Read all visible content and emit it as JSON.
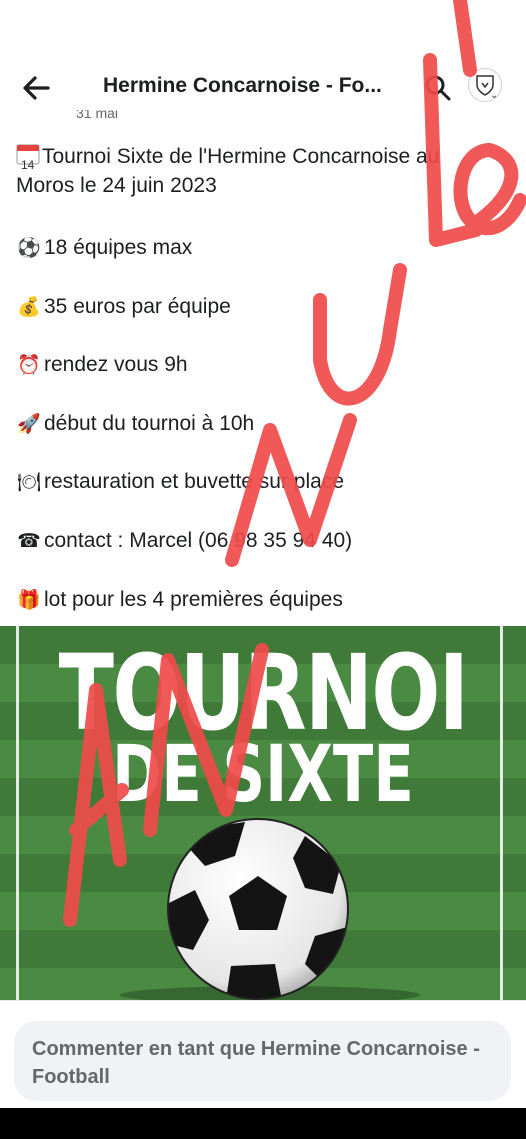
{
  "header": {
    "title": "Hermine Concarnoise - Fo...",
    "timestamp": "31 mai"
  },
  "post": {
    "title_line_1": "Tournoi Sixte de l'Hermine Concarnoise au",
    "title_line_2": "Moros le 24 juin 2023",
    "calendar_day": "14",
    "items": [
      {
        "icon": "soccer-ball-icon",
        "emoji": "⚽",
        "text": "18 équipes max"
      },
      {
        "icon": "money-bag-icon",
        "emoji": "💰",
        "text": "35 euros par équipe"
      },
      {
        "icon": "alarm-clock-icon",
        "emoji": "⏰",
        "text": "rendez vous 9h"
      },
      {
        "icon": "rocket-icon",
        "emoji": "🚀",
        "text": "début du tournoi à 10h"
      },
      {
        "icon": "plate-icon",
        "emoji": "🍽",
        "text": "restauration et buvette sur place"
      },
      {
        "icon": "telephone-icon",
        "emoji": "☎",
        "text": "contact : Marcel (06 98 35 94 40)"
      },
      {
        "icon": "gift-icon",
        "emoji": "🎁",
        "text": "lot pour les 4 premières équipes"
      }
    ]
  },
  "poster": {
    "line_1": "TOURNOI",
    "line_2": "DE SIXTE"
  },
  "overlay": {
    "handwritten_text": "ANNULÉ",
    "color": "#f04a4a"
  },
  "comment": {
    "placeholder": "Commenter en tant que Hermine Concarnoise - Football"
  },
  "colors": {
    "text": "#1c1e21",
    "secondary": "#65676b",
    "pitch_dark": "#3f7a38",
    "pitch_light": "#4a8a42"
  }
}
